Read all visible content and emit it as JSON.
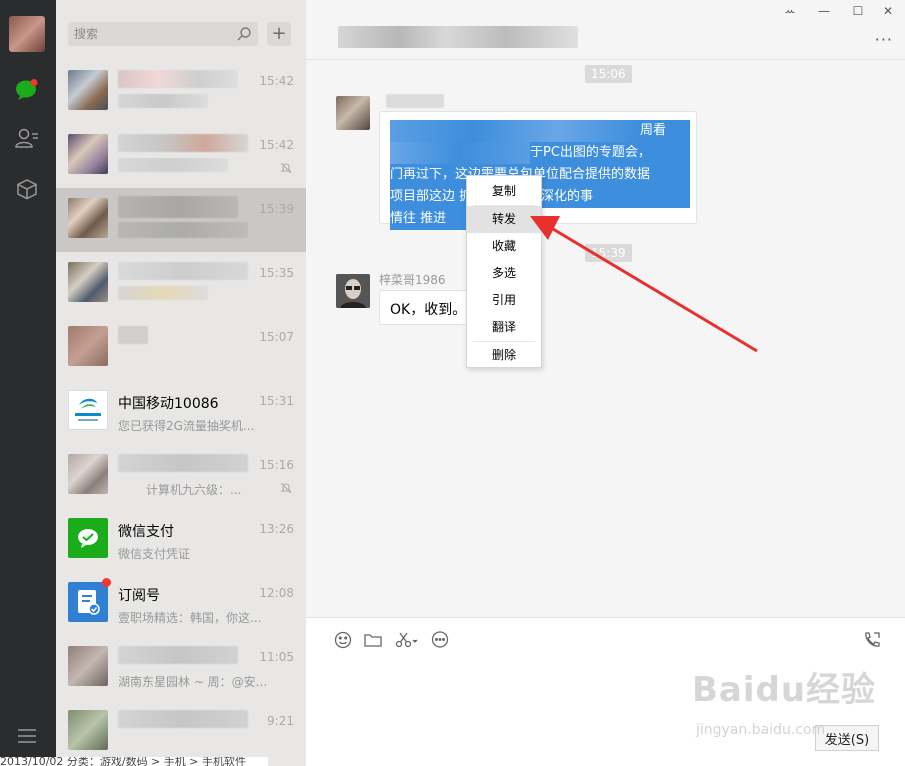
{
  "search": {
    "placeholder": "搜索"
  },
  "list_actions": {
    "plus": "+"
  },
  "conversations": [
    {
      "name": "",
      "preview": "",
      "time": "15:42",
      "muted": false
    },
    {
      "name": "",
      "preview": "",
      "time": "15:42",
      "muted": true
    },
    {
      "name": "",
      "preview": "",
      "time": "15:39",
      "muted": false,
      "active": true
    },
    {
      "name": "",
      "preview": "",
      "time": "15:35",
      "muted": false
    },
    {
      "name": "",
      "preview": "",
      "time": "15:07",
      "muted": false
    },
    {
      "name": "中国移动10086",
      "preview": "您已获得2G流量抽奖机...",
      "time": "15:31",
      "muted": false,
      "avatar_text": "中国移动 ChinaMobile"
    },
    {
      "name": "",
      "preview": "计算机九六级：...",
      "time": "15:16",
      "muted": true
    },
    {
      "name": "微信支付",
      "preview": "微信支付凭证",
      "time": "13:26",
      "muted": false
    },
    {
      "name": "订阅号",
      "preview": "壹职场精选：韩国，你这...",
      "time": "12:08",
      "muted": false,
      "unread_dot": true
    },
    {
      "name": "",
      "preview": "湖南东星园林 ~ 周：@安...",
      "time": "11:05",
      "muted": false
    },
    {
      "name": "",
      "preview": "",
      "time": "9:21",
      "muted": false
    }
  ],
  "window": {
    "pin": "ꕀ",
    "minimize": "—",
    "maximize": "☐",
    "close": "✕",
    "more": "···"
  },
  "chat": {
    "time1": "15:06",
    "selected_lines": [
      "周看",
      "于PC出图的专题会，",
      "门再过下，这边需要总包单位配合提供的数据",
      "项目部这边 抓紧把PC图纸深化的事",
      "情往 推进"
    ],
    "time2": "15:39",
    "sender": "梓菜哥1986",
    "reply": "OK，收到。"
  },
  "context_menu": [
    "复制",
    "转发",
    "收藏",
    "多选",
    "引用",
    "翻译",
    "删除"
  ],
  "input": {
    "send_label": "发送(S)"
  },
  "watermark": {
    "logo": "Baidu经验",
    "url": "jingyan.baidu.com"
  },
  "footer": {
    "text": "2013/10/02  分类：游戏/数码 > 手机 > 手机软件"
  },
  "colors": {
    "rail": "#2b2c2e",
    "list_bg": "#e8e7e6",
    "selection": "#3d8edc",
    "arrow": "#e8312f",
    "wechat_green": "#1aad19"
  }
}
